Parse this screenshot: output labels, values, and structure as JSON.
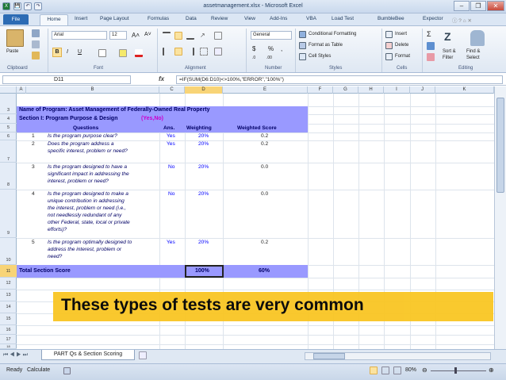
{
  "window": {
    "title": "assetmanagement.xlsx  -  Microsoft Excel",
    "min": "–",
    "max": "❐",
    "close": "✕"
  },
  "quick_access": [
    "💾",
    "↶",
    "↷"
  ],
  "tabs": [
    "File",
    "Home",
    "Insert",
    "Page Layout",
    "Formulas",
    "Data",
    "Review",
    "View",
    "Add-Ins",
    "VBA",
    "Load Test",
    "BumbleBee",
    "Expector"
  ],
  "ribbon": {
    "clipboard": {
      "label": "Clipboard",
      "paste": "Paste"
    },
    "font": {
      "label": "Font",
      "name": "Arial",
      "size": "12",
      "bold": "B",
      "italic": "I",
      "underline": "U",
      "grow": "A˄",
      "shrink": "A˅"
    },
    "alignment": {
      "label": "Alignment"
    },
    "number": {
      "label": "Number",
      "format": "General",
      "currency": "$",
      "percent": "%",
      "comma": ","
    },
    "styles": {
      "label": "Styles",
      "conditional": "Conditional Formatting",
      "table": "Format as Table",
      "cell": "Cell Styles"
    },
    "cells": {
      "label": "Cells",
      "insert": "Insert",
      "delete": "Delete",
      "format": "Format"
    },
    "editing": {
      "label": "Editing",
      "sort": "Sort &",
      "filter": "Filter",
      "find": "Find &",
      "select": "Select",
      "sigma": "Σ"
    }
  },
  "formula_bar": {
    "name_box": "D11",
    "fx": "fx",
    "formula": "=IF(SUM(D6:D10)<>100%,\"ERROR\",\"100%\")"
  },
  "columns": [
    "A",
    "B",
    "C",
    "D",
    "E",
    "F",
    "G",
    "H",
    "I",
    "J",
    "K"
  ],
  "rows": [
    "3",
    "4",
    "5",
    "6",
    "7",
    "8",
    "9",
    "10",
    "11",
    "12",
    "13",
    "14",
    "15",
    "16",
    "17",
    "18"
  ],
  "sheet": {
    "program": "Name of Program:  Asset Management of Federally-Owned Real Property",
    "section": "Section I:  Program Purpose & Design",
    "yesno": "(Yes,No)",
    "headers": {
      "questions": "Questions",
      "ans": "Ans.",
      "weighting": "Weighting",
      "score": "Weighted Score"
    },
    "items": [
      {
        "num": "1",
        "lines": [
          "Is the program purpose clear?"
        ],
        "ans": "Yes",
        "weight": "20%",
        "score": "0.2"
      },
      {
        "num": "2",
        "lines": [
          "Does the program address a",
          "specific interest, problem or need?"
        ],
        "ans": "Yes",
        "weight": "20%",
        "score": "0.2"
      },
      {
        "num": "3",
        "lines": [
          "Is the program designed to have a",
          "significant impact in addressing the",
          "interest, problem or need?"
        ],
        "ans": "No",
        "weight": "20%",
        "score": "0.0"
      },
      {
        "num": "4",
        "lines": [
          "Is the program designed to make a",
          "unique contribution in addressing",
          "the interest, problem or need (i.e.,",
          "not needlessly redundant of any",
          "other Federal, state, local or private",
          "efforts)?"
        ],
        "ans": "No",
        "weight": "20%",
        "score": "0.0"
      },
      {
        "num": "5",
        "lines": [
          "Is the program optimally designed to",
          "address the interest, problem or",
          "need?"
        ],
        "ans": "Yes",
        "weight": "20%",
        "score": "0.2"
      }
    ],
    "total": {
      "label": "Total Section Score",
      "weight": "100%",
      "score": "60%"
    }
  },
  "banner": "These types of tests are very common",
  "sheet_tab": "PART Qs & Section Scoring",
  "status": {
    "ready": "Ready",
    "calculate": "Calculate",
    "zoom": "80%"
  },
  "colors": {
    "section_bg": "#9999ff",
    "banner_bg": "#f9c623",
    "question_text": "#000066",
    "answer_text": "#0000ff",
    "yesno": "#cc00cc"
  }
}
